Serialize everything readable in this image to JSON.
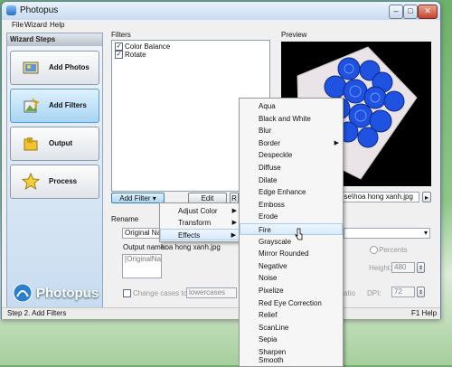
{
  "window": {
    "title": "Photopus",
    "close_glyph": "✕",
    "min_glyph": "–",
    "max_glyph": "□"
  },
  "menu": [
    "File",
    "Wizard",
    "Help"
  ],
  "sidebar": {
    "header": "Wizard Steps",
    "steps": [
      {
        "label": "Add Photos",
        "icon": "photos-icon"
      },
      {
        "label": "Add Filters",
        "icon": "filters-icon"
      },
      {
        "label": "Output",
        "icon": "output-icon"
      },
      {
        "label": "Process",
        "icon": "process-icon"
      }
    ],
    "brand": "Photopus"
  },
  "filters": {
    "label": "Filters",
    "items": [
      {
        "label": "Color Balance",
        "checked": true
      },
      {
        "label": "Rotate",
        "checked": true
      }
    ],
    "add_button": "Add Filter",
    "edit_button": "Edit",
    "remove_button": "R"
  },
  "preview": {
    "label": "Preview",
    "path": "ose\\hoa hong xanh.jpg",
    "next_glyph": "▸"
  },
  "rename": {
    "label": "Rename",
    "pattern": "Original Nam",
    "output_name_label": "Output name:",
    "output_name": "hoa hong xanh.jpg",
    "template": "[OriginalName]",
    "change_cases_label": "Change cases to:",
    "case_value": "lowercases"
  },
  "resize": {
    "percents_label": "Percents",
    "height_label": "Height:",
    "height_value": "480",
    "ratio_label": "atio",
    "dpi_label": "DPI:",
    "dpi_value": "72"
  },
  "add_filter_menu": [
    {
      "label": "Adjust Color",
      "submenu": true
    },
    {
      "label": "Transform",
      "submenu": true
    },
    {
      "label": "Effects",
      "submenu": true
    }
  ],
  "effects_menu": [
    "Aqua",
    "Black and White",
    "Blur",
    "Border",
    "Despeckle",
    "Diffuse",
    "Dilate",
    "Edge Enhance",
    "Emboss",
    "Erode",
    "Fire",
    "Grayscale",
    "Mirror Rounded",
    "Negative",
    "Noise",
    "Pixelize",
    "Red Eye Correction",
    "Relief",
    "ScanLine",
    "Sepia",
    "Sharpen",
    "Smooth"
  ],
  "effects_highlighted": "Fire",
  "status": {
    "left": "Step 2. Add Filters",
    "right": "F1 Help"
  },
  "colors": {
    "accent": "#3c7fb1",
    "rose": "#1f52e0"
  }
}
